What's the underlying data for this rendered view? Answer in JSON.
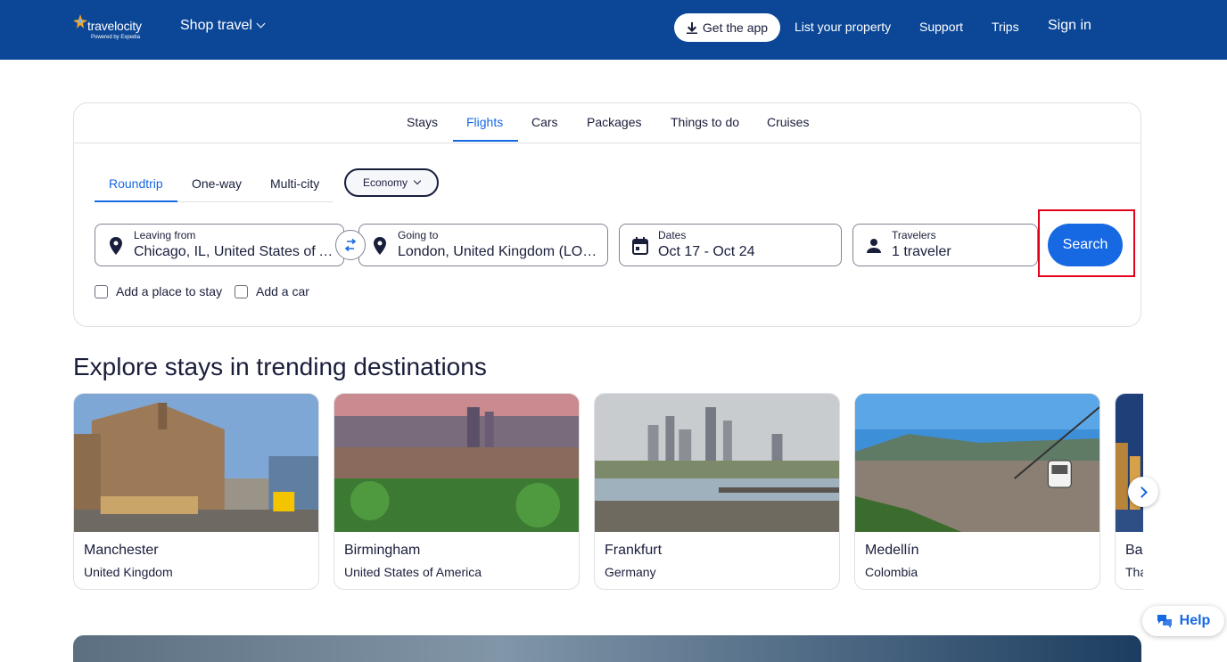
{
  "header": {
    "logo_text": "travelocity",
    "powered_by": "Powered by Expedia",
    "shop_travel": "Shop travel",
    "get_app": "Get the app",
    "list_property": "List your property",
    "support": "Support",
    "trips": "Trips",
    "sign_in": "Sign in",
    "bg_color": "#0c4797"
  },
  "search_card": {
    "tabs": [
      {
        "label": "Stays"
      },
      {
        "label": "Flights",
        "active": true
      },
      {
        "label": "Cars"
      },
      {
        "label": "Packages"
      },
      {
        "label": "Things to do"
      },
      {
        "label": "Cruises"
      }
    ],
    "trip_types": [
      {
        "label": "Roundtrip",
        "active": true
      },
      {
        "label": "One-way"
      },
      {
        "label": "Multi-city"
      }
    ],
    "cabin_class": "Economy",
    "leaving_from": {
      "label": "Leaving from",
      "value": "Chicago, IL, United States of America"
    },
    "going_to": {
      "label": "Going to",
      "value": "London, United Kingdom (LON-All Airports)"
    },
    "dates": {
      "label": "Dates",
      "value": "Oct 17 - Oct 24"
    },
    "travelers": {
      "label": "Travelers",
      "value": "1 traveler"
    },
    "search_button": "Search",
    "add_stay": "Add a place to stay",
    "add_car": "Add a car",
    "accent_color": "#1668e3",
    "highlight_color": "#e3001b"
  },
  "trending": {
    "title": "Explore stays in trending destinations",
    "destinations": [
      {
        "city": "Manchester",
        "country": "United Kingdom"
      },
      {
        "city": "Birmingham",
        "country": "United States of America"
      },
      {
        "city": "Frankfurt",
        "country": "Germany"
      },
      {
        "city": "Medellín",
        "country": "Colombia"
      },
      {
        "city": "Bangkok",
        "country": "Thailand"
      }
    ]
  },
  "help": {
    "label": "Help"
  }
}
